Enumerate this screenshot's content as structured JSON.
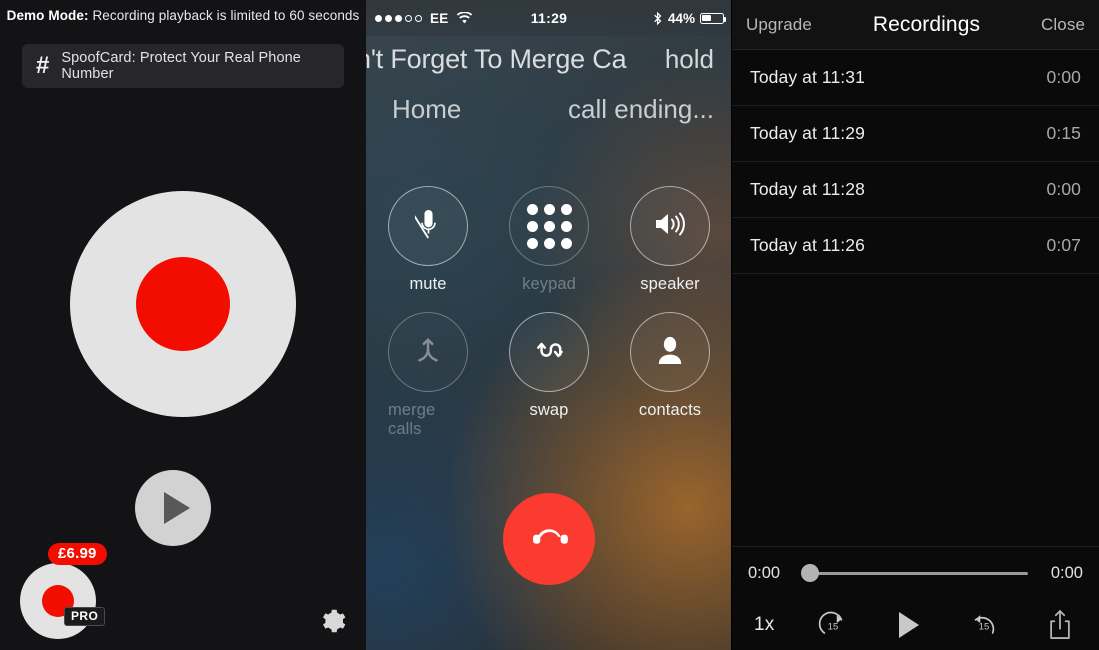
{
  "recorder": {
    "demo_banner_bold": "Demo Mode:",
    "demo_banner_text": " Recording playback is limited to 60 seconds",
    "spoof_icon": "hash-icon",
    "spoof_text": "SpoofCard: Protect Your Real Phone Number",
    "record_button_name": "record-button",
    "play_button_name": "play-button",
    "pro_price": "£6.99",
    "pro_badge": "PRO",
    "settings_icon": "gear-icon",
    "colors": {
      "record_red": "#f20d00",
      "record_ring": "#e3e3e3",
      "background": "#131315"
    }
  },
  "phone": {
    "statusbar": {
      "signal_filled": 3,
      "signal_total": 5,
      "carrier": "EE",
      "wifi_icon": "wifi-icon",
      "time": "11:29",
      "bluetooth_icon": "bluetooth-icon",
      "battery_percent": "44%",
      "battery_level": 44
    },
    "call_a": {
      "name": "n't Forget To Merge Ca",
      "status": "Home"
    },
    "call_b": {
      "name": "hold",
      "status": "call ending..."
    },
    "controls": [
      {
        "icon": "mute-microphone-icon",
        "label": "mute",
        "disabled": false
      },
      {
        "icon": "keypad-icon",
        "label": "keypad",
        "disabled": true
      },
      {
        "icon": "speaker-icon",
        "label": "speaker",
        "disabled": false
      },
      {
        "icon": "merge-calls-icon",
        "label": "merge calls",
        "disabled": true
      },
      {
        "icon": "swap-icon",
        "label": "swap",
        "disabled": false
      },
      {
        "icon": "contacts-person-icon",
        "label": "contacts",
        "disabled": false
      }
    ],
    "end_call": {
      "icon": "end-call-handset-icon",
      "color": "#fb3b30"
    }
  },
  "recordings": {
    "header": {
      "left_action": "Upgrade",
      "title": "Recordings",
      "right_action": "Close"
    },
    "rows": [
      {
        "label": "Today at 11:31",
        "duration": "0:00"
      },
      {
        "label": "Today at 11:29",
        "duration": "0:15"
      },
      {
        "label": "Today at 11:28",
        "duration": "0:00"
      },
      {
        "label": "Today at 11:26",
        "duration": "0:07"
      }
    ],
    "player": {
      "elapsed": "0:00",
      "remaining": "0:00",
      "progress_percent": 0,
      "speed": "1x",
      "skip_forward_label": "15",
      "skip_back_label": "15",
      "play_icon": "play-icon",
      "share_icon": "share-upload-icon"
    }
  }
}
